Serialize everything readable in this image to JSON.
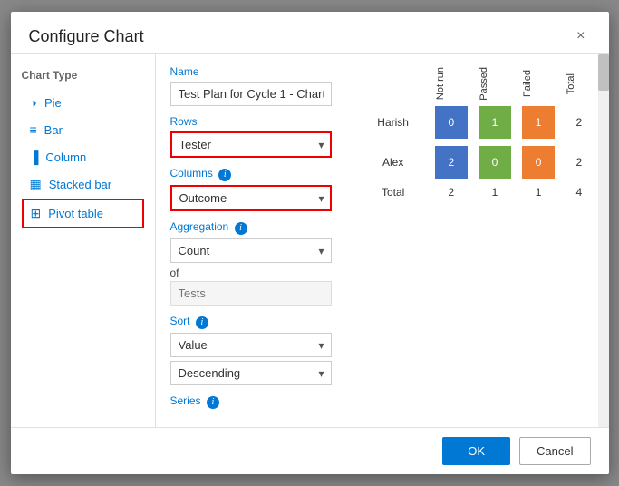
{
  "dialog": {
    "title": "Configure Chart",
    "close_label": "×"
  },
  "left": {
    "label": "Chart Type",
    "items": [
      {
        "id": "pie",
        "label": "Pie",
        "icon": "◑"
      },
      {
        "id": "bar",
        "label": "Bar",
        "icon": "☰"
      },
      {
        "id": "column",
        "label": "Column",
        "icon": "▦"
      },
      {
        "id": "stacked-bar",
        "label": "Stacked bar",
        "icon": "▦"
      },
      {
        "id": "pivot-table",
        "label": "Pivot table",
        "icon": "⊞",
        "selected": true
      }
    ]
  },
  "middle": {
    "name_label": "Name",
    "name_value": "Test Plan for Cycle 1 - Chart",
    "rows_label": "Rows",
    "rows_value": "Tester",
    "columns_label": "Columns",
    "columns_value": "Outcome",
    "aggregation_label": "Aggregation",
    "aggregation_value": "Count",
    "of_label": "of",
    "of_placeholder": "Tests",
    "sort_label": "Sort",
    "sort_value": "Value",
    "sort_dir_value": "Descending",
    "series_label": "Series"
  },
  "chart": {
    "col_headers": [
      "Not run",
      "Passed",
      "Failed",
      "Total"
    ],
    "rows": [
      {
        "label": "Harish",
        "values": [
          0,
          1,
          1
        ],
        "total": 2
      },
      {
        "label": "Alex",
        "values": [
          2,
          0,
          0
        ],
        "total": 2
      }
    ],
    "totals": {
      "label": "Total",
      "values": [
        2,
        1,
        1
      ],
      "grand_total": 4
    }
  },
  "footer": {
    "ok_label": "OK",
    "cancel_label": "Cancel"
  }
}
